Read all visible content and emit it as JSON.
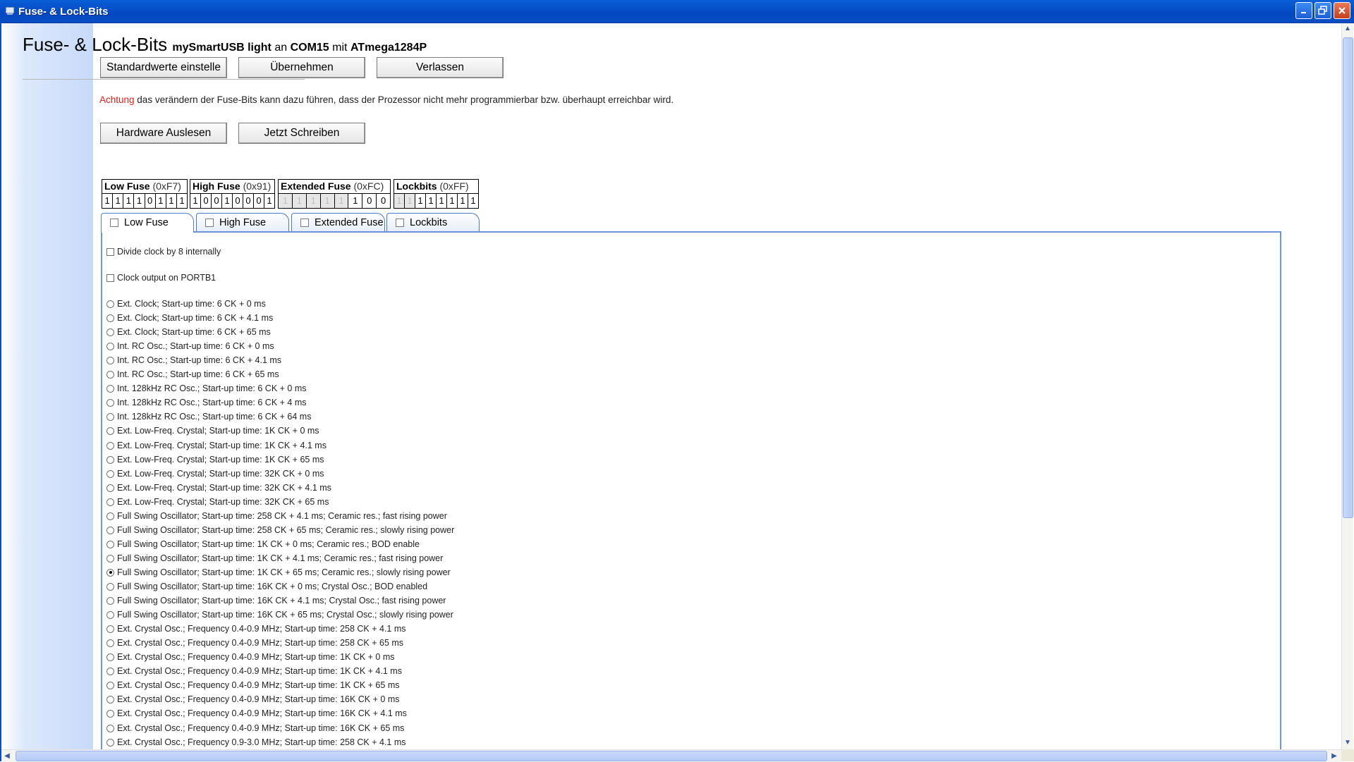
{
  "window": {
    "title": "Fuse- & Lock-Bits",
    "minimize_icon": "minimize-icon",
    "maximize_icon": "restore-icon",
    "close_icon": "close-icon"
  },
  "header": {
    "title": "Fuse- & Lock-Bits",
    "programmer": "mySmartUSB light",
    "word_an": "an",
    "port": "COM15",
    "word_mit": "mit",
    "device": "ATmega1284P"
  },
  "buttons": {
    "defaults": "Standardwerte einstelle",
    "apply": "Übernehmen",
    "exit": "Verlassen",
    "read_hw": "Hardware Auslesen",
    "write_now": "Jetzt Schreiben"
  },
  "warning": {
    "keyword": "Achtung",
    "text": " das verändern der Fuse-Bits kann dazu führen, dass der Prozessor nicht mehr programmierbar bzw. überhaupt erreichbar wird."
  },
  "fuses": [
    {
      "name": "Low Fuse",
      "hex": "(0xF7)",
      "bits": [
        "1",
        "1",
        "1",
        "1",
        "0",
        "1",
        "1",
        "1"
      ],
      "dim": [
        false,
        false,
        false,
        false,
        false,
        false,
        false,
        false
      ]
    },
    {
      "name": "High Fuse",
      "hex": "(0x91)",
      "bits": [
        "1",
        "0",
        "0",
        "1",
        "0",
        "0",
        "0",
        "1"
      ],
      "dim": [
        false,
        false,
        false,
        false,
        false,
        false,
        false,
        false
      ]
    },
    {
      "name": "Extended Fuse",
      "hex": "(0xFC)",
      "bits": [
        "1",
        "1",
        "1",
        "1",
        "1",
        "1",
        "0",
        "0"
      ],
      "dim": [
        true,
        true,
        true,
        true,
        true,
        false,
        false,
        false
      ]
    },
    {
      "name": "Lockbits",
      "hex": "(0xFF)",
      "bits": [
        "1",
        "1",
        "1",
        "1",
        "1",
        "1",
        "1",
        "1"
      ],
      "dim": [
        true,
        true,
        false,
        false,
        false,
        false,
        false,
        false
      ]
    }
  ],
  "tabs": [
    "Low Fuse",
    "High Fuse",
    "Extended Fuse",
    "Lockbits"
  ],
  "checkbox_options": [
    "Divide clock by 8 internally",
    "Clock output on PORTB1"
  ],
  "radio_selected_index": 19,
  "radio_options": [
    "Ext. Clock; Start-up time: 6 CK + 0 ms",
    "Ext. Clock; Start-up time: 6 CK + 4.1 ms",
    "Ext. Clock; Start-up time: 6 CK + 65 ms",
    "Int. RC Osc.; Start-up time: 6 CK + 0 ms",
    "Int. RC Osc.; Start-up time: 6 CK + 4.1 ms",
    "Int. RC Osc.; Start-up time: 6 CK + 65 ms",
    "Int. 128kHz RC Osc.; Start-up time: 6 CK + 0 ms",
    "Int. 128kHz RC Osc.; Start-up time: 6 CK + 4 ms",
    "Int. 128kHz RC Osc.; Start-up time: 6 CK + 64 ms",
    "Ext. Low-Freq. Crystal; Start-up time: 1K CK + 0 ms",
    "Ext. Low-Freq. Crystal; Start-up time: 1K CK + 4.1 ms",
    "Ext. Low-Freq. Crystal; Start-up time: 1K CK + 65 ms",
    "Ext. Low-Freq. Crystal; Start-up time: 32K CK + 0 ms",
    "Ext. Low-Freq. Crystal; Start-up time: 32K CK + 4.1 ms",
    "Ext. Low-Freq. Crystal; Start-up time: 32K CK + 65 ms",
    "Full Swing Oscillator; Start-up time: 258 CK + 4.1 ms; Ceramic res.; fast rising power",
    "Full Swing Oscillator; Start-up time: 258 CK + 65 ms; Ceramic res.; slowly rising power",
    "Full Swing Oscillator; Start-up time: 1K CK + 0 ms; Ceramic res.; BOD enable",
    "Full Swing Oscillator; Start-up time: 1K CK + 4.1 ms; Ceramic res.; fast rising power",
    "Full Swing Oscillator; Start-up time: 1K CK + 65 ms; Ceramic res.; slowly rising power",
    "Full Swing Oscillator; Start-up time: 16K CK + 0 ms; Crystal Osc.; BOD enabled",
    "Full Swing Oscillator; Start-up time: 16K CK + 4.1 ms; Crystal Osc.; fast rising power",
    "Full Swing Oscillator; Start-up time: 16K CK + 65 ms; Crystal Osc.; slowly rising power",
    "Ext. Crystal Osc.; Frequency 0.4-0.9 MHz; Start-up time: 258 CK + 4.1 ms",
    "Ext. Crystal Osc.; Frequency 0.4-0.9 MHz; Start-up time: 258 CK + 65 ms",
    "Ext. Crystal Osc.; Frequency 0.4-0.9 MHz; Start-up time: 1K CK + 0 ms",
    "Ext. Crystal Osc.; Frequency 0.4-0.9 MHz; Start-up time: 1K CK + 4.1 ms",
    "Ext. Crystal Osc.; Frequency 0.4-0.9 MHz; Start-up time: 1K CK + 65 ms",
    "Ext. Crystal Osc.; Frequency 0.4-0.9 MHz; Start-up time: 16K CK + 0 ms",
    "Ext. Crystal Osc.; Frequency 0.4-0.9 MHz; Start-up time: 16K CK + 4.1 ms",
    "Ext. Crystal Osc.; Frequency 0.4-0.9 MHz; Start-up time: 16K CK + 65 ms",
    "Ext. Crystal Osc.; Frequency 0.9-3.0 MHz; Start-up time: 258 CK + 4.1 ms"
  ],
  "colors": {
    "titlebar": "#0348c2",
    "warning_red": "#d9221c",
    "tab_border": "#6b95d8"
  }
}
